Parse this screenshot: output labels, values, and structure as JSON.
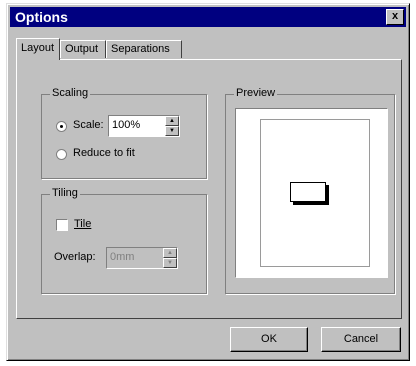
{
  "window": {
    "title": "Options",
    "close_glyph": "x"
  },
  "tabs": [
    {
      "label": "Layout",
      "active": true
    },
    {
      "label": "Output",
      "active": false
    },
    {
      "label": "Separations",
      "active": false
    }
  ],
  "scaling": {
    "legend": "Scaling",
    "scale_label": "Scale:",
    "scale_value": "100%",
    "scale_selected": true,
    "reduce_label": "Reduce to fit",
    "reduce_selected": false
  },
  "tiling": {
    "legend": "Tiling",
    "tile_label": "Tile",
    "tile_checked": false,
    "overlap_label": "Overlap:",
    "overlap_value": "0mm",
    "overlap_enabled": false
  },
  "preview": {
    "legend": "Preview"
  },
  "buttons": {
    "ok": "OK",
    "cancel": "Cancel"
  }
}
